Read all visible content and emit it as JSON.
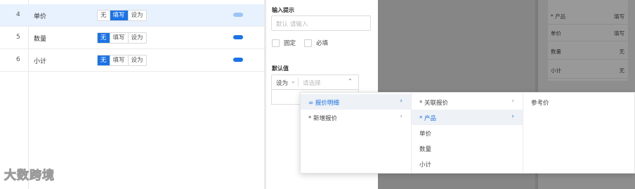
{
  "table": {
    "rows": [
      {
        "num": "4",
        "name": "单价",
        "options": [
          "无",
          "填写",
          "设为"
        ],
        "selected": "填写",
        "toggle_on": false,
        "highlighted": true
      },
      {
        "num": "5",
        "name": "数量",
        "options": [
          "无",
          "填写",
          "设为"
        ],
        "selected": "无",
        "toggle_on": true,
        "highlighted": false
      },
      {
        "num": "6",
        "name": "小计",
        "options": [
          "无",
          "填写",
          "设为"
        ],
        "selected": "无",
        "toggle_on": true,
        "highlighted": false
      }
    ]
  },
  "watermark": "大数跨境",
  "form": {
    "hint_label": "输入提示",
    "hint_placeholder": "默认 请输入",
    "fixed_label": "固定",
    "required_label": "必填",
    "default_label": "默认值",
    "default_prefix": "设为",
    "default_placeholder": "请选择"
  },
  "cascader": {
    "col1": [
      {
        "label": "= 报价明细",
        "active": true,
        "has_children": true
      },
      {
        "label": "* 新增报价",
        "active": false,
        "has_children": true
      }
    ],
    "col2": [
      {
        "label": "* 关联报价",
        "active": false,
        "has_children": true
      },
      {
        "label": "* 产品",
        "active": true,
        "has_children": true
      },
      {
        "label": "单价",
        "active": false,
        "has_children": false
      },
      {
        "label": "数量",
        "active": false,
        "has_children": false
      },
      {
        "label": "小计",
        "active": false,
        "has_children": false
      }
    ],
    "col3": [
      {
        "label": "参考价",
        "active": false,
        "has_children": false
      }
    ]
  },
  "background_panel": {
    "rows": [
      {
        "label": "* 产品",
        "value": "填写"
      },
      {
        "label": "单价",
        "value": "填写"
      },
      {
        "label": "数量",
        "value": "无"
      },
      {
        "label": "小计",
        "value": "无"
      }
    ]
  },
  "colors": {
    "accent": "#1a73e8",
    "overlay": "#868686"
  }
}
